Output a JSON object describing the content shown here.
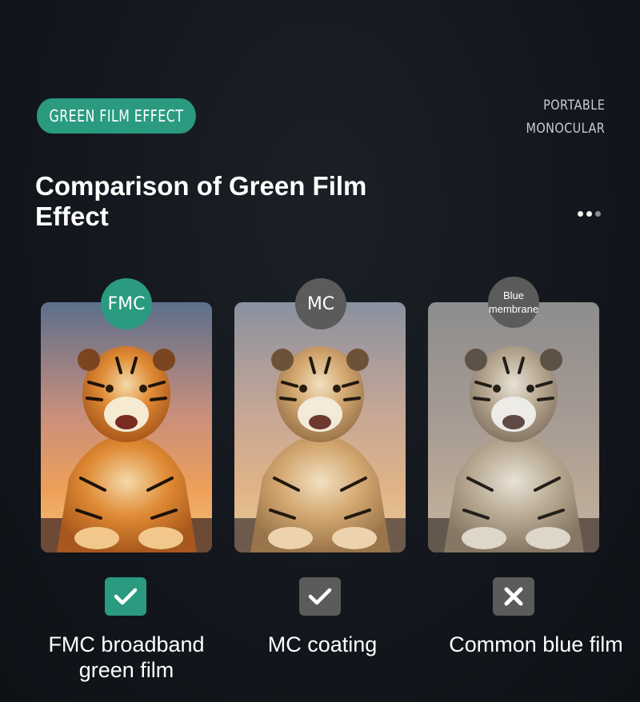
{
  "header": {
    "tag_label": "GREEN FILM EFFECT",
    "corner_line1": "PORTABLE",
    "corner_line2": "MONOCULAR",
    "title": "Comparison of Green Film Effect"
  },
  "pager": {
    "dots": 3,
    "active": 2
  },
  "colors": {
    "accent": "#2a9a80",
    "neutral": "#5b5b5b",
    "background": "#13171d"
  },
  "comparisons": [
    {
      "badge": "FMC",
      "result": "check",
      "caption_line1": "FMC broadband",
      "caption_line2": "green film",
      "tint": "vivid"
    },
    {
      "badge": "MC",
      "result": "check",
      "caption_line1": "MC coating",
      "caption_line2": "",
      "tint": "muted"
    },
    {
      "badge": "Blue membrane",
      "result": "cross",
      "caption_line1": "Common blue film",
      "caption_line2": "",
      "tint": "washed"
    }
  ]
}
